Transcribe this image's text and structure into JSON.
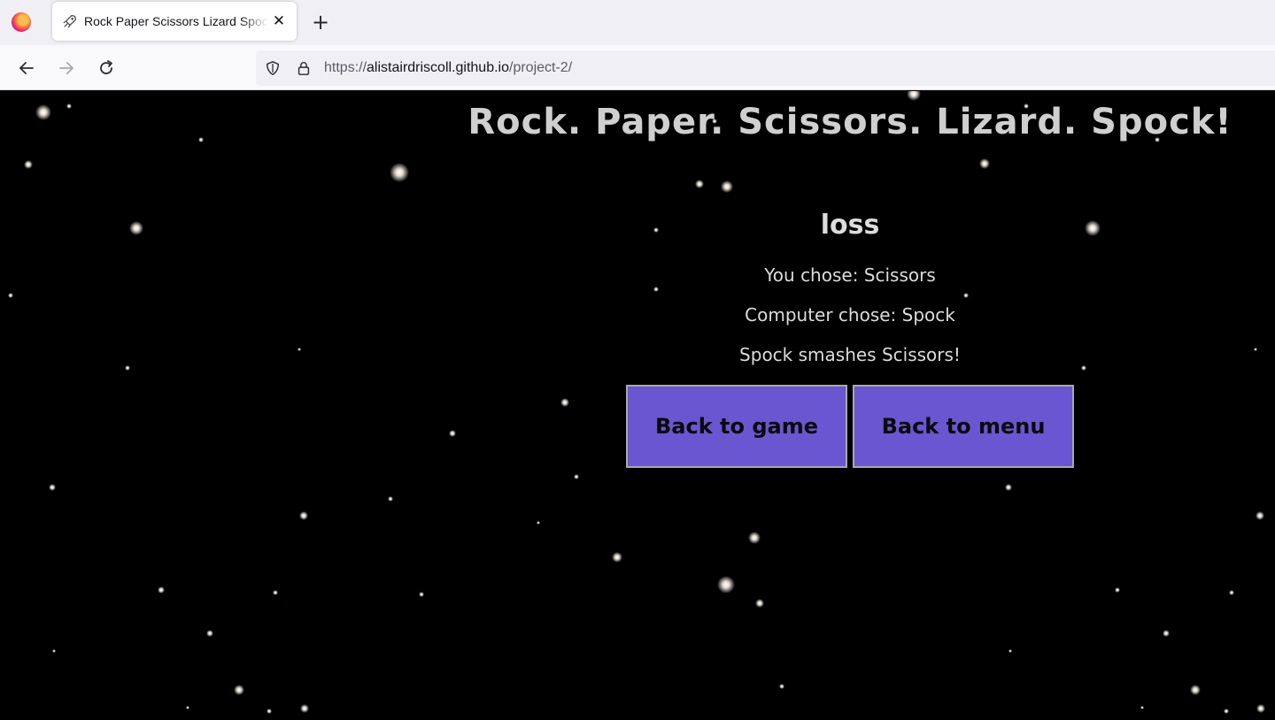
{
  "browser": {
    "tab_title": "Rock Paper Scissors Lizard Spock",
    "url_scheme": "https://",
    "url_host": "alistairdriscoll.github.io",
    "url_path": "/project-2/",
    "icons": {
      "browser_logo": "firefox-logo-icon",
      "tab_favicon": "rocket-icon",
      "tab_close": "close-icon",
      "new_tab": "plus-icon",
      "back": "arrow-left-icon",
      "forward": "arrow-right-icon",
      "reload": "reload-icon",
      "tracking": "shield-icon",
      "secure": "lock-icon"
    },
    "glyphs": {
      "close": "✕",
      "new_tab": "+"
    }
  },
  "game": {
    "title": "Rock. Paper. Scissors. Lizard. Spock!",
    "result": "loss",
    "player_choice_text": "You chose: Scissors",
    "computer_choice_text": "Computer chose: Spock",
    "outcome_text": "Spock smashes Scissors!",
    "buttons": {
      "back_to_game": "Back to game",
      "back_to_menu": "Back to menu"
    }
  },
  "colors": {
    "page_background": "#000000",
    "text": "#dcdcdc",
    "button_background": "#6a56d1",
    "button_border": "#a9a9a9",
    "button_text": "#0a0a0a",
    "star": "#ffffff"
  }
}
